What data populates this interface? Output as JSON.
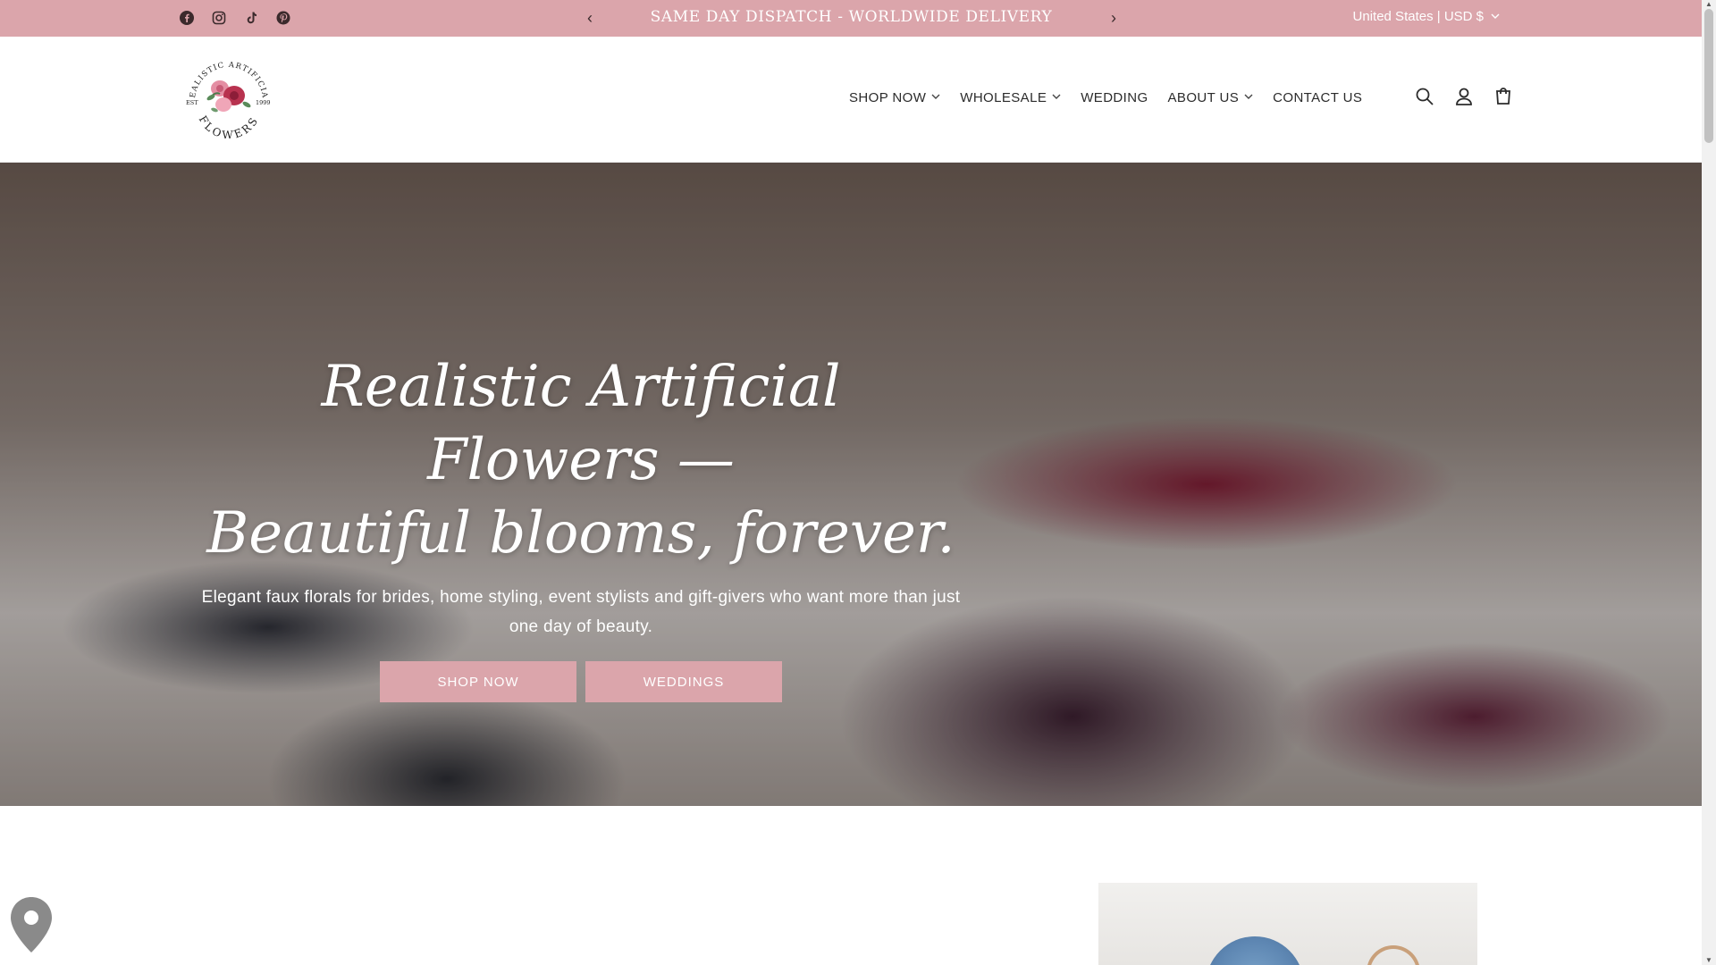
{
  "announcement": {
    "text": "SAME DAY DISPATCH - WORLDWIDE DELIVERY",
    "country": "United States | USD $"
  },
  "social": [
    "facebook-icon",
    "instagram-icon",
    "tiktok-icon",
    "pinterest-icon"
  ],
  "header": {
    "logo": {
      "top_text": "REALISTIC ARTIFICIAL",
      "est": "EST",
      "year": "1999",
      "bottom_text": "FLOWERS"
    },
    "nav": [
      {
        "label": "SHOP NOW",
        "dropdown": true
      },
      {
        "label": "WHOLESALE",
        "dropdown": true
      },
      {
        "label": "WEDDING",
        "dropdown": false
      },
      {
        "label": "ABOUT US",
        "dropdown": true
      },
      {
        "label": "CONTACT US",
        "dropdown": false
      }
    ],
    "icons": [
      "search-icon",
      "account-icon",
      "cart-icon"
    ]
  },
  "hero": {
    "title_line1": "Realistic Artificial Flowers —",
    "title_line2": "Beautiful blooms, forever.",
    "subtitle": "Elegant faux florals for brides, home styling, event stylists and gift-givers who want more than just one day of beauty.",
    "buttons": {
      "shop": "SHOP NOW",
      "weddings": "WEDDINGS"
    }
  },
  "colors": {
    "brand": "#dba5ab",
    "text": "#2b2b2b",
    "announcement_text": "#ffffff"
  }
}
